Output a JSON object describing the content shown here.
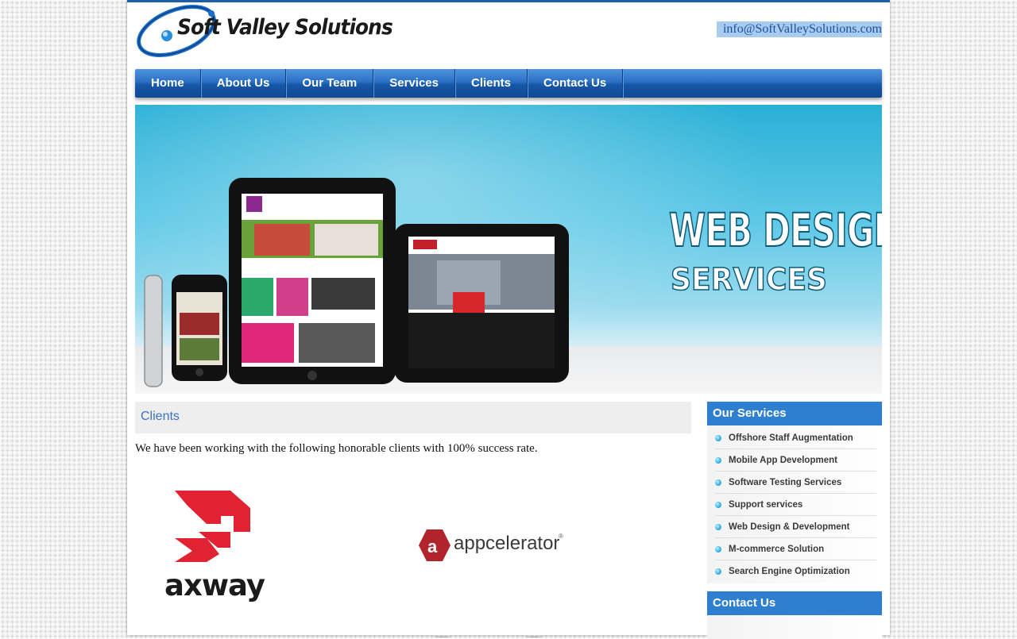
{
  "header": {
    "logo_text": "Soft Valley Solutions",
    "email": "info@SoftValleySolutions.com"
  },
  "nav": {
    "items": [
      {
        "label": "Home"
      },
      {
        "label": "About Us"
      },
      {
        "label": "Our Team"
      },
      {
        "label": "Services"
      },
      {
        "label": "Clients"
      },
      {
        "label": "Contact Us"
      }
    ]
  },
  "banner": {
    "title": "WEB DESIGN",
    "subtitle": "SERVICES"
  },
  "main": {
    "section_title": "Clients",
    "intro": "We have been working with the following honorable clients with 100% success rate.",
    "clients": [
      {
        "name": "axway"
      },
      {
        "name": "appcelerator"
      }
    ]
  },
  "sidebar": {
    "services_title": "Our Services",
    "services": [
      "Offshore Staff Augmentation",
      "Mobile App Development",
      "Software Testing Services",
      "Support services",
      "Web Design & Development",
      "M-commerce Solution",
      "Search Engine Optimization"
    ],
    "contact_title": "Contact Us"
  },
  "colors": {
    "nav_blue": "#1e5fa8",
    "sidebar_header": "#2f7fd0",
    "link_blue": "#3b72c0",
    "axway_red": "#e02232",
    "appcelerator_red": "#b2242c"
  }
}
